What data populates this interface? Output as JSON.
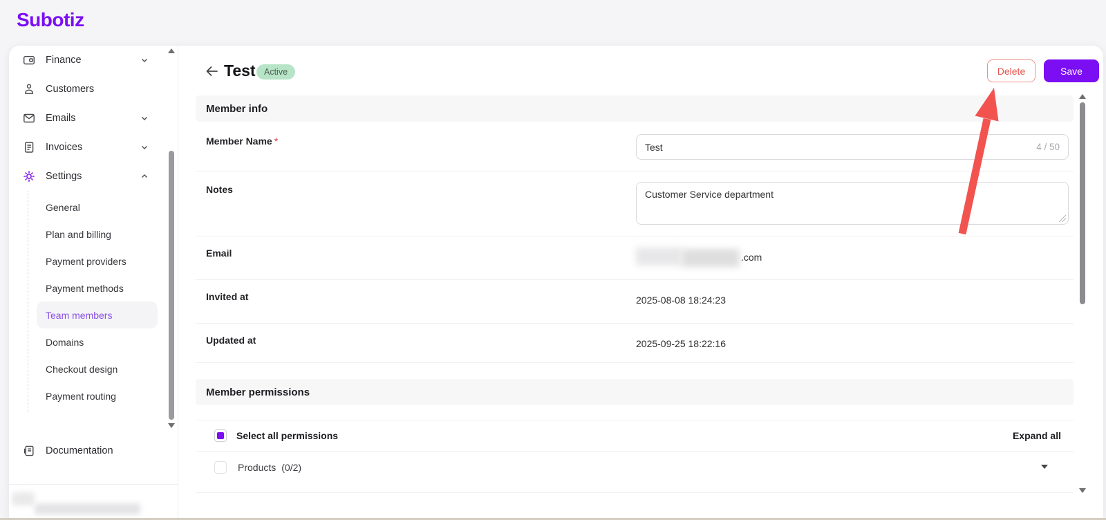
{
  "brand": {
    "logo_text": "Subotiz"
  },
  "sidebar": {
    "items": [
      {
        "label": "Finance"
      },
      {
        "label": "Customers"
      },
      {
        "label": "Emails"
      },
      {
        "label": "Invoices"
      },
      {
        "label": "Settings"
      }
    ],
    "settings_subitems": [
      {
        "label": "General"
      },
      {
        "label": "Plan and billing"
      },
      {
        "label": "Payment providers"
      },
      {
        "label": "Payment methods"
      },
      {
        "label": "Team members"
      },
      {
        "label": "Domains"
      },
      {
        "label": "Checkout design"
      },
      {
        "label": "Payment routing"
      }
    ],
    "documentation_label": "Documentation"
  },
  "header": {
    "title": "Test",
    "status": "Active",
    "delete_label": "Delete",
    "save_label": "Save"
  },
  "member_info": {
    "section_title": "Member info",
    "member_name_label": "Member Name",
    "required_mark": "*",
    "member_name_value": "Test",
    "member_name_counter": "4 / 50",
    "notes_label": "Notes",
    "notes_value": "Customer Service department",
    "email_label": "Email",
    "email_visible_suffix": ".com",
    "invited_at_label": "Invited at",
    "invited_at_value": "2025-08-08 18:24:23",
    "updated_at_label": "Updated at",
    "updated_at_value": "2025-09-25 18:22:16"
  },
  "permissions": {
    "section_title": "Member permissions",
    "select_all_label": "Select all permissions",
    "expand_all_label": "Expand all",
    "products_label": "Products",
    "products_count": "(0/2)"
  },
  "colors": {
    "accent_purple": "#7b0ef2",
    "danger_red": "#e4524e",
    "badge_green_bg": "#b7e4c7",
    "annotation_arrow_red": "#f2534f"
  }
}
